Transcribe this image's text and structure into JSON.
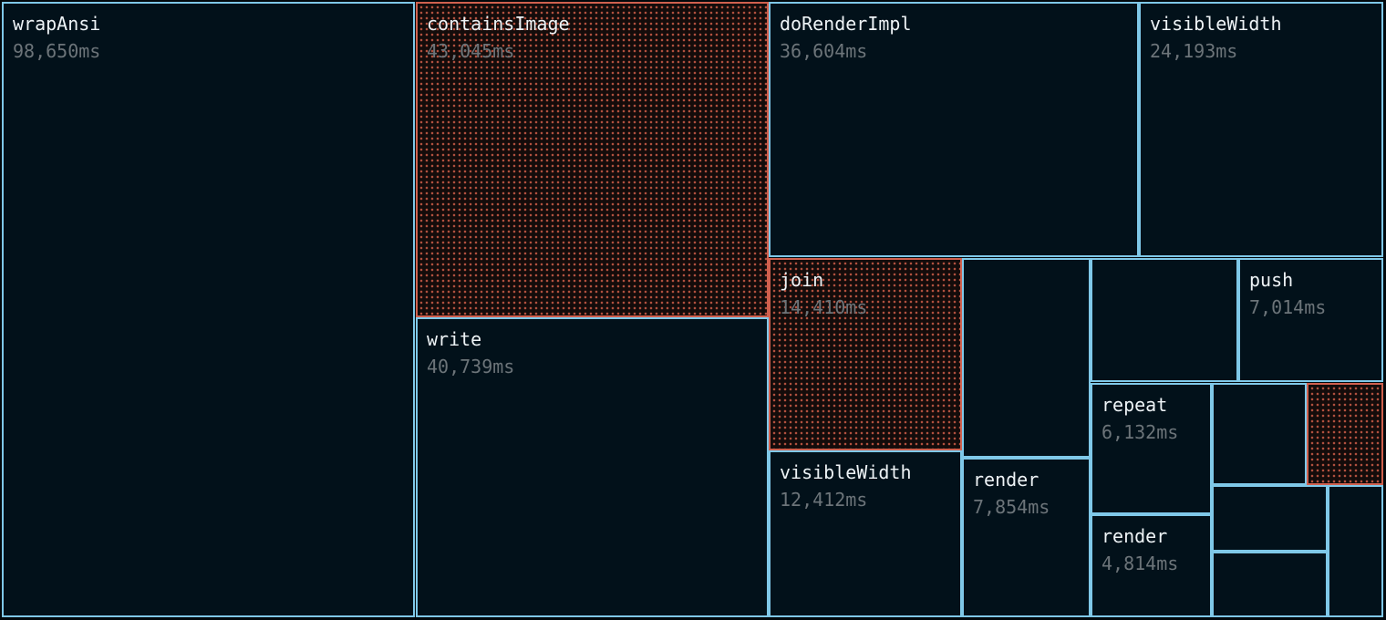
{
  "chart_data": {
    "type": "treemap",
    "unit": "ms",
    "colors": {
      "normal_border": "#7fc8e8",
      "hot_border": "#d0604e",
      "background": "#02111a"
    },
    "items": [
      {
        "name": "wrapAnsi",
        "label": "98,650ms",
        "value": 98650,
        "highlight": false
      },
      {
        "name": "containsImage",
        "label": "43,045ms",
        "value": 43045,
        "highlight": true
      },
      {
        "name": "write",
        "label": "40,739ms",
        "value": 40739,
        "highlight": false
      },
      {
        "name": "doRenderImpl",
        "label": "36,604ms",
        "value": 36604,
        "highlight": false
      },
      {
        "name": "visibleWidth",
        "label": "24,193ms",
        "value": 24193,
        "highlight": false
      },
      {
        "name": "join",
        "label": "14,410ms",
        "value": 14410,
        "highlight": true
      },
      {
        "name": "visibleWidth",
        "label": "12,412ms",
        "value": 12412,
        "highlight": false
      },
      {
        "name": "",
        "label": "",
        "value": null,
        "highlight": false
      },
      {
        "name": "render",
        "label": "7,854ms",
        "value": 7854,
        "highlight": false
      },
      {
        "name": "",
        "label": "",
        "value": null,
        "highlight": false
      },
      {
        "name": "push",
        "label": "7,014ms",
        "value": 7014,
        "highlight": false
      },
      {
        "name": "repeat",
        "label": "6,132ms",
        "value": 6132,
        "highlight": false
      },
      {
        "name": "render",
        "label": "4,814ms",
        "value": 4814,
        "highlight": false
      },
      {
        "name": "",
        "label": "",
        "value": null,
        "highlight": false
      },
      {
        "name": "",
        "label": "",
        "value": null,
        "highlight": true
      },
      {
        "name": "",
        "label": "",
        "value": null,
        "highlight": false
      },
      {
        "name": "",
        "label": "",
        "value": null,
        "highlight": false
      },
      {
        "name": "",
        "label": "",
        "value": null,
        "highlight": false
      }
    ]
  }
}
